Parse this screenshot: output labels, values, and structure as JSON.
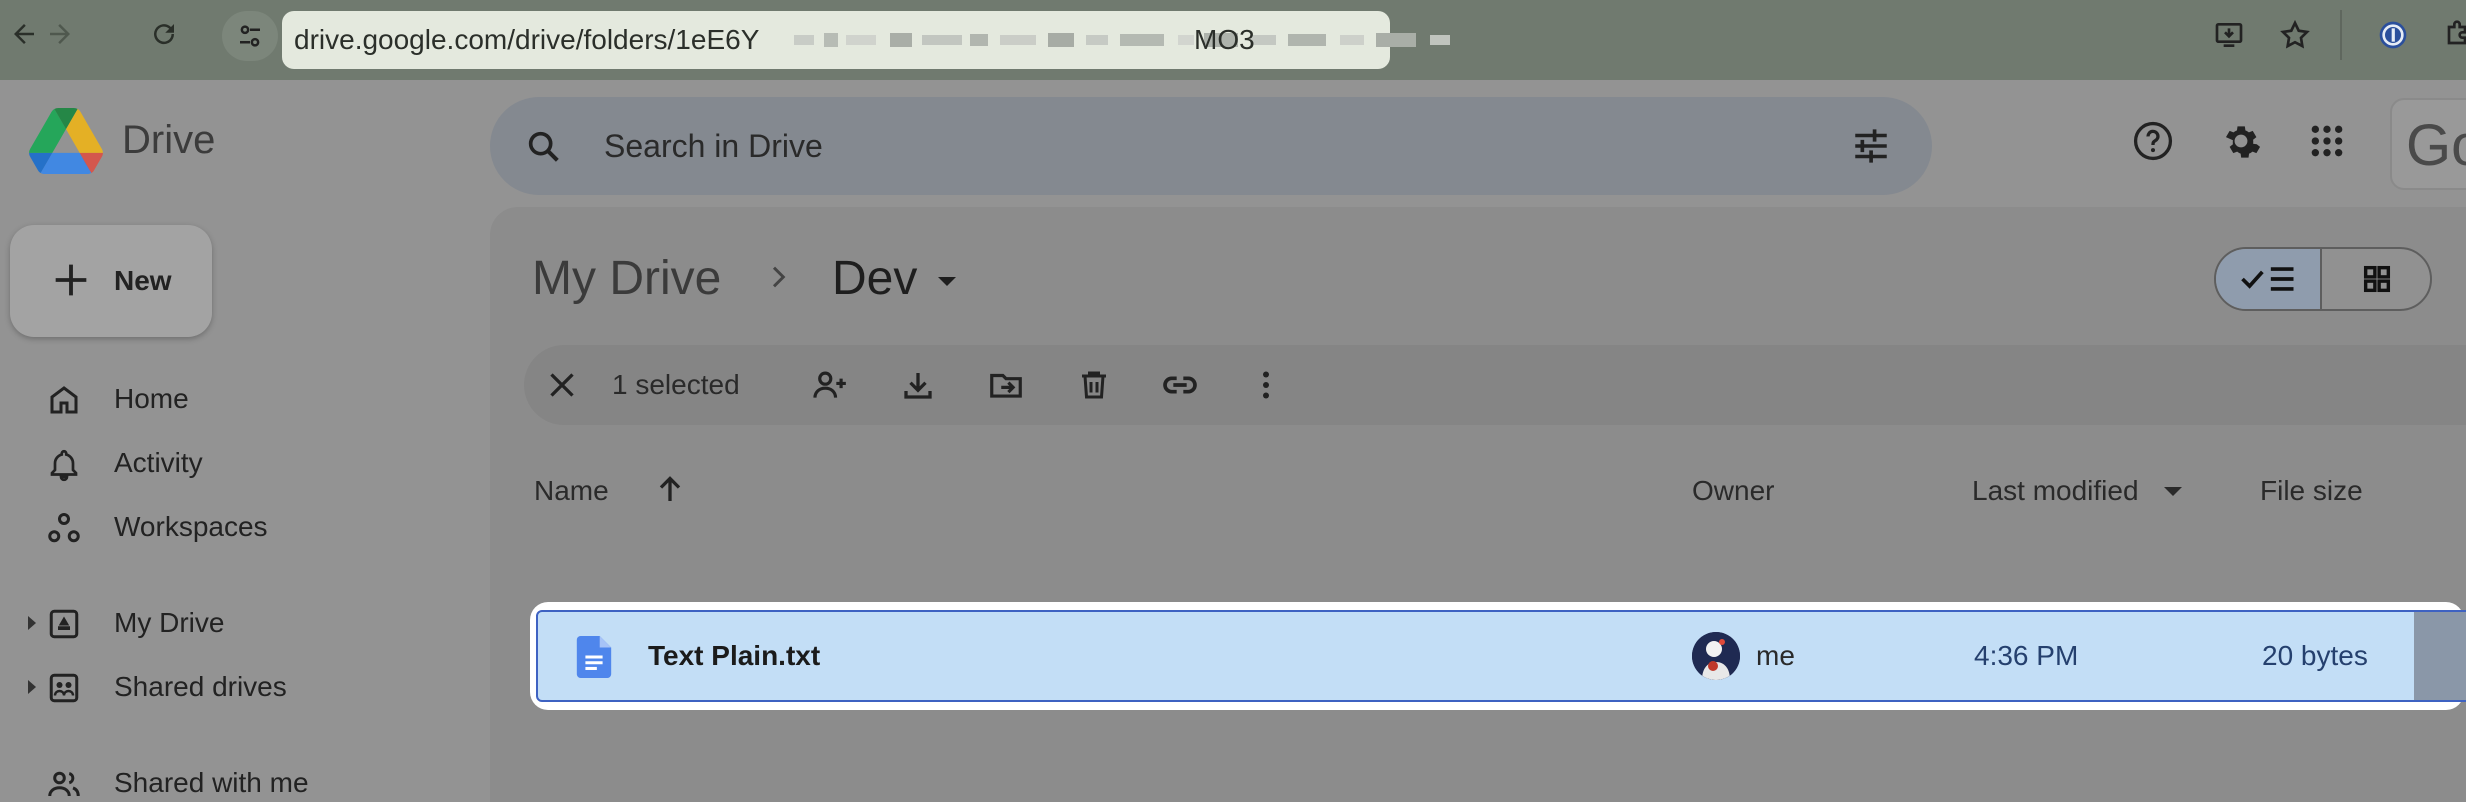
{
  "browser": {
    "url": "drive.google.com/drive/folders/1eE6Y",
    "url_end": "MO3",
    "back_icon": "arrow-left-icon",
    "forward_icon": "arrow-right-icon",
    "reload_icon": "reload-icon"
  },
  "app": {
    "name": "Drive",
    "search_placeholder": "Search in Drive",
    "account_text": "Go"
  },
  "sidebar": {
    "new_label": "New",
    "items": [
      {
        "label": "Home",
        "icon": "home-icon"
      },
      {
        "label": "Activity",
        "icon": "bell-icon"
      },
      {
        "label": "Workspaces",
        "icon": "workspaces-icon"
      },
      {
        "label": "My Drive",
        "icon": "my-drive-icon"
      },
      {
        "label": "Shared drives",
        "icon": "shared-drives-icon"
      },
      {
        "label": "Shared with me",
        "icon": "people-icon"
      }
    ]
  },
  "breadcrumb": {
    "root": "My Drive",
    "current": "Dev"
  },
  "selection_bar": {
    "count_label": "1 selected"
  },
  "columns": {
    "name": "Name",
    "owner": "Owner",
    "modified": "Last modified",
    "size": "File size"
  },
  "files": [
    {
      "name": "Text Plain.txt",
      "owner": "me",
      "modified": "4:36 PM",
      "size": "20 bytes",
      "selected": true
    }
  ],
  "colors": {
    "selected_row": "#c3def6",
    "selected_border": "#3e62c2"
  }
}
